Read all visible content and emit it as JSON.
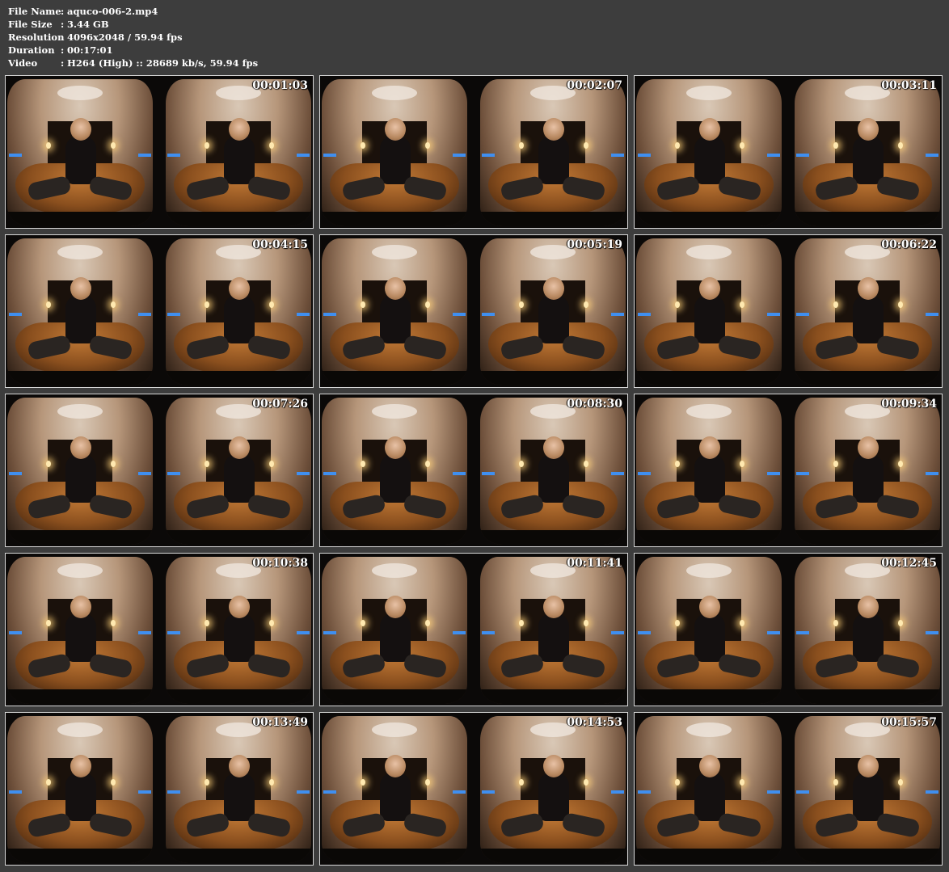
{
  "meta": [
    {
      "key": "File Name",
      "sep": ":",
      "value": "aquco-006-2.mp4"
    },
    {
      "key": "File Size",
      "sep": ":",
      "value": "3.44 GB"
    },
    {
      "key": "Resolution",
      "sep": ":",
      "value": "4096x2048 / 59.94 fps"
    },
    {
      "key": "Duration",
      "sep": ":",
      "value": "00:17:01"
    },
    {
      "key": "Video",
      "sep": ":",
      "value": "H264 (High) :: 28689 kb/s, 59.94 fps"
    }
  ],
  "thumbnails": [
    {
      "timestamp": "00:01:03"
    },
    {
      "timestamp": "00:02:07"
    },
    {
      "timestamp": "00:03:11"
    },
    {
      "timestamp": "00:04:15"
    },
    {
      "timestamp": "00:05:19"
    },
    {
      "timestamp": "00:06:22"
    },
    {
      "timestamp": "00:07:26"
    },
    {
      "timestamp": "00:08:30"
    },
    {
      "timestamp": "00:09:34"
    },
    {
      "timestamp": "00:10:38"
    },
    {
      "timestamp": "00:11:41"
    },
    {
      "timestamp": "00:12:45"
    },
    {
      "timestamp": "00:13:49"
    },
    {
      "timestamp": "00:14:53"
    },
    {
      "timestamp": "00:15:57"
    }
  ],
  "colors": {
    "background": "#3d3d3d",
    "text": "#ffffff",
    "thumb_border": "#d8d8d8"
  }
}
